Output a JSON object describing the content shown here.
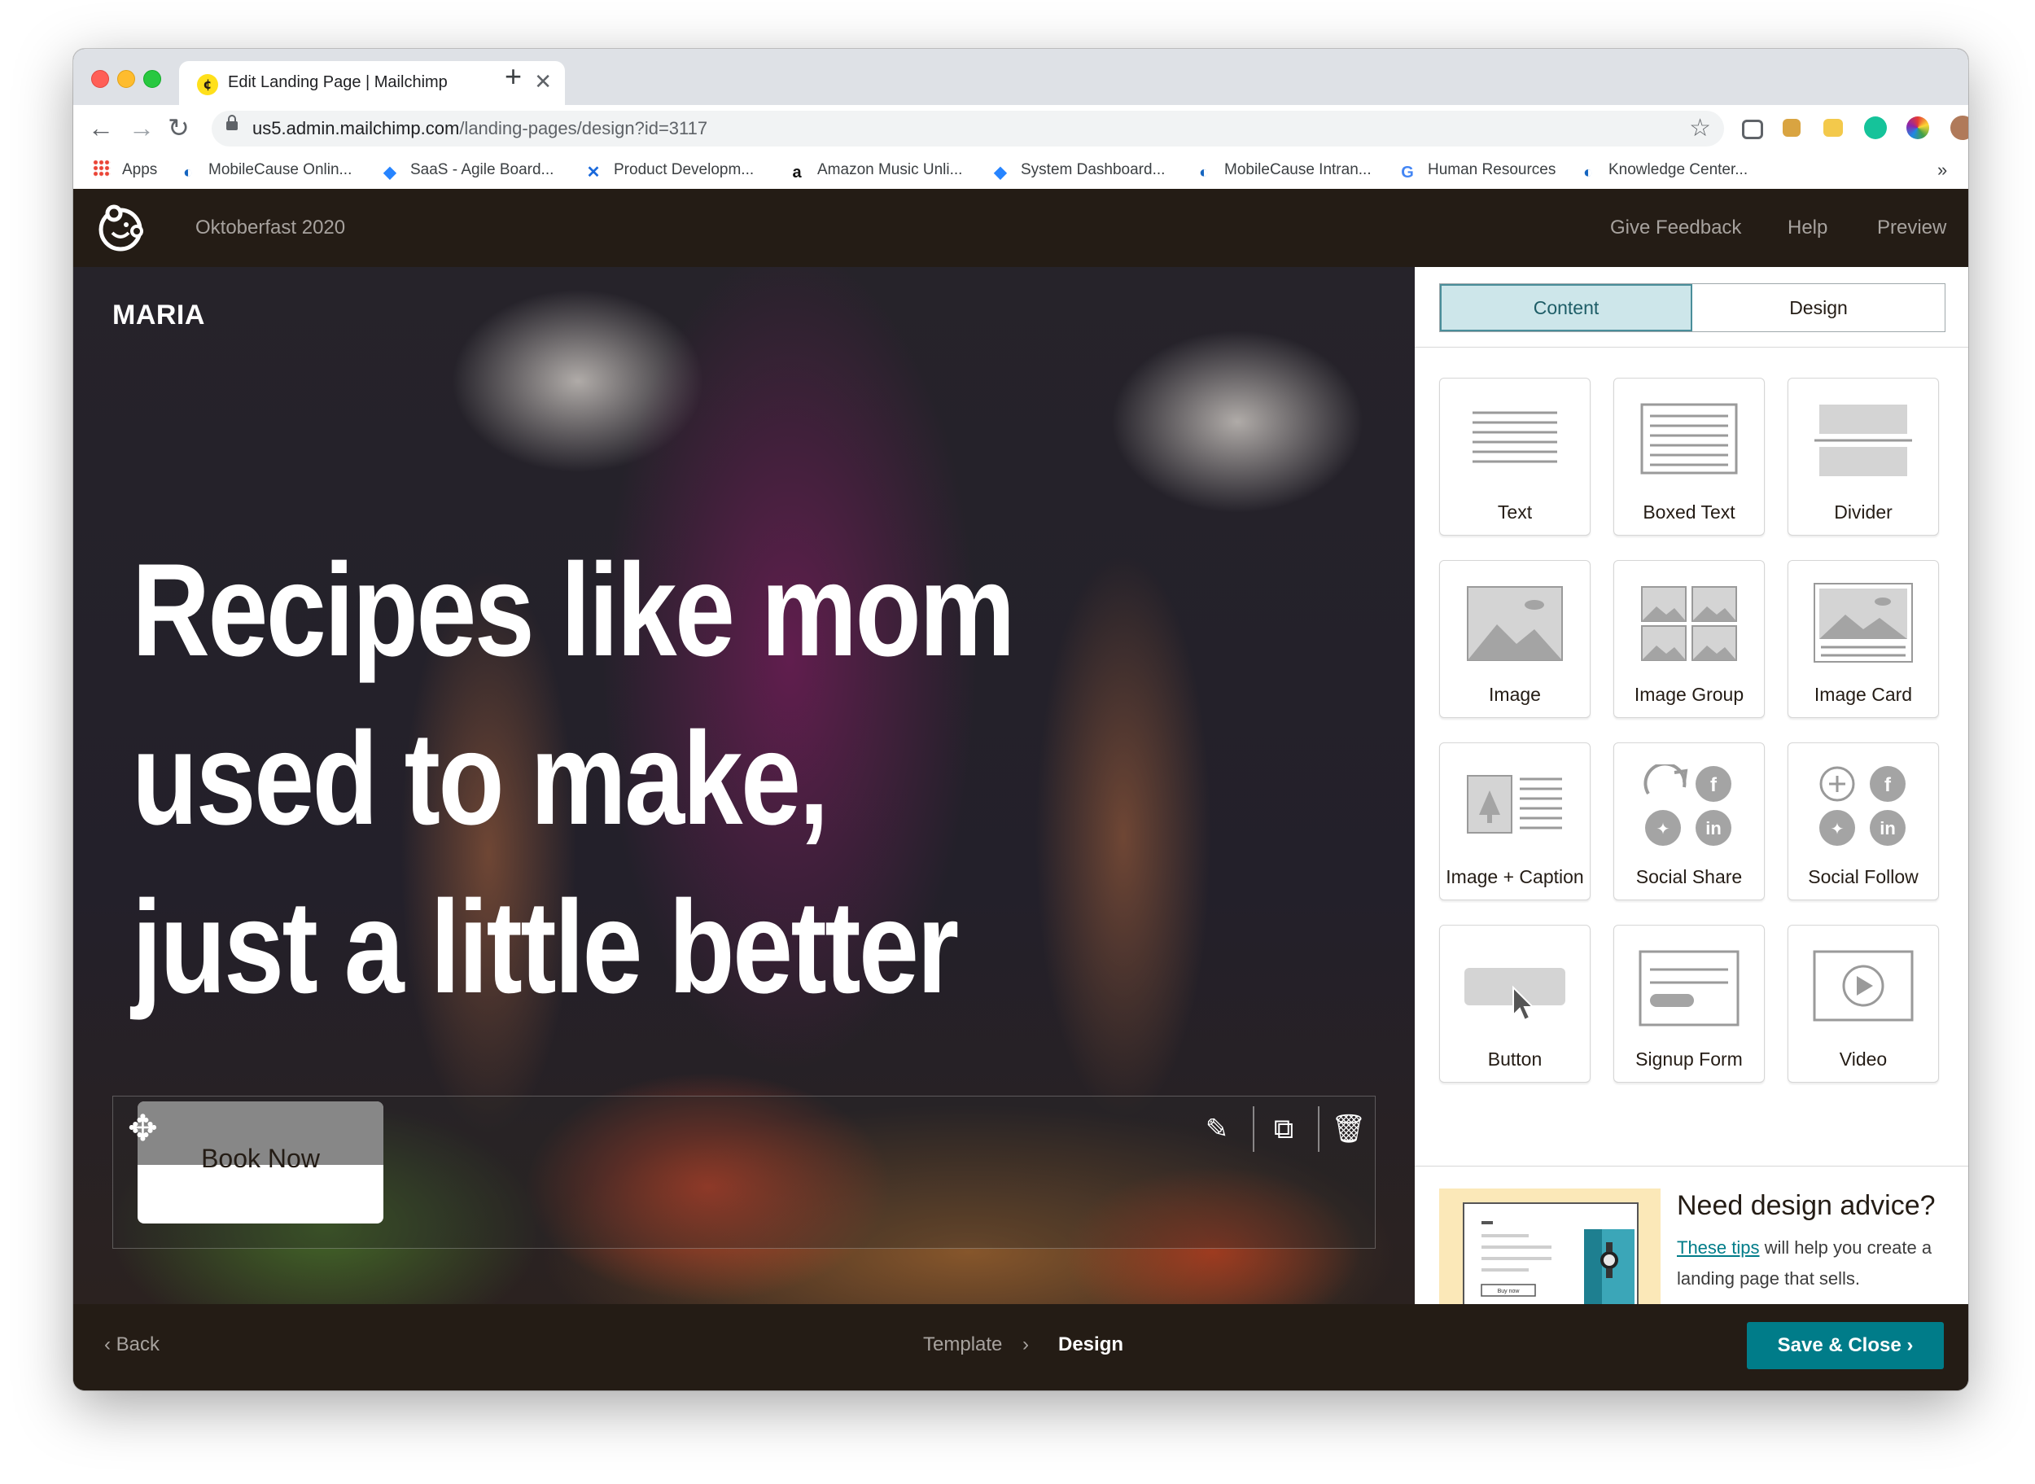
{
  "browser": {
    "tab_title": "Edit Landing Page | Mailchimp",
    "tab_close": "✕",
    "new_tab": "+",
    "url_host": "us5.admin.mailchimp.com",
    "url_path": "/landing-pages/design?id=3117",
    "more_bookmarks": "»",
    "bookmarks": [
      {
        "label": "Apps",
        "icon": "apps-grid-icon"
      },
      {
        "label": "MobileCause Onlin...",
        "icon": "mobilecause-icon"
      },
      {
        "label": "SaaS - Agile Board...",
        "icon": "jira-icon"
      },
      {
        "label": "Product Developm...",
        "icon": "confluence-icon"
      },
      {
        "label": "Amazon Music Unli...",
        "icon": "amazon-icon"
      },
      {
        "label": "System Dashboard...",
        "icon": "jira-icon"
      },
      {
        "label": "MobileCause Intran...",
        "icon": "mobilecause-icon"
      },
      {
        "label": "Human Resources",
        "icon": "google-icon"
      },
      {
        "label": "Knowledge Center...",
        "icon": "mobilecause-icon"
      }
    ]
  },
  "header": {
    "campaign_name": "Oktoberfast 2020",
    "links": [
      "Give Feedback",
      "Help",
      "Preview"
    ]
  },
  "canvas": {
    "brand": "MARIA",
    "headline_lines": [
      "Recipes like mom",
      "used to make,",
      "just a little better"
    ],
    "button_label": "Book Now"
  },
  "panel": {
    "tabs": [
      "Content",
      "Design"
    ],
    "active_tab": "Content",
    "blocks": [
      "Text",
      "Boxed Text",
      "Divider",
      "Image",
      "Image Group",
      "Image Card",
      "Image + Caption",
      "Social Share",
      "Social Follow",
      "Button",
      "Signup Form",
      "Video"
    ],
    "advice_title": "Need design advice?",
    "advice_link": "These tips",
    "advice_text": " will help you create a landing page that sells.",
    "advice_thumb_button": "Buy now"
  },
  "footer": {
    "back": "Back",
    "steps": [
      "Template",
      "Design"
    ],
    "current_step": "Design",
    "save_label": "Save & Close"
  },
  "colors": {
    "header_bg": "#241c15",
    "accent": "#007c89",
    "active_tab_bg": "#cde6ea",
    "advice_bg": "#fbe8b8"
  }
}
